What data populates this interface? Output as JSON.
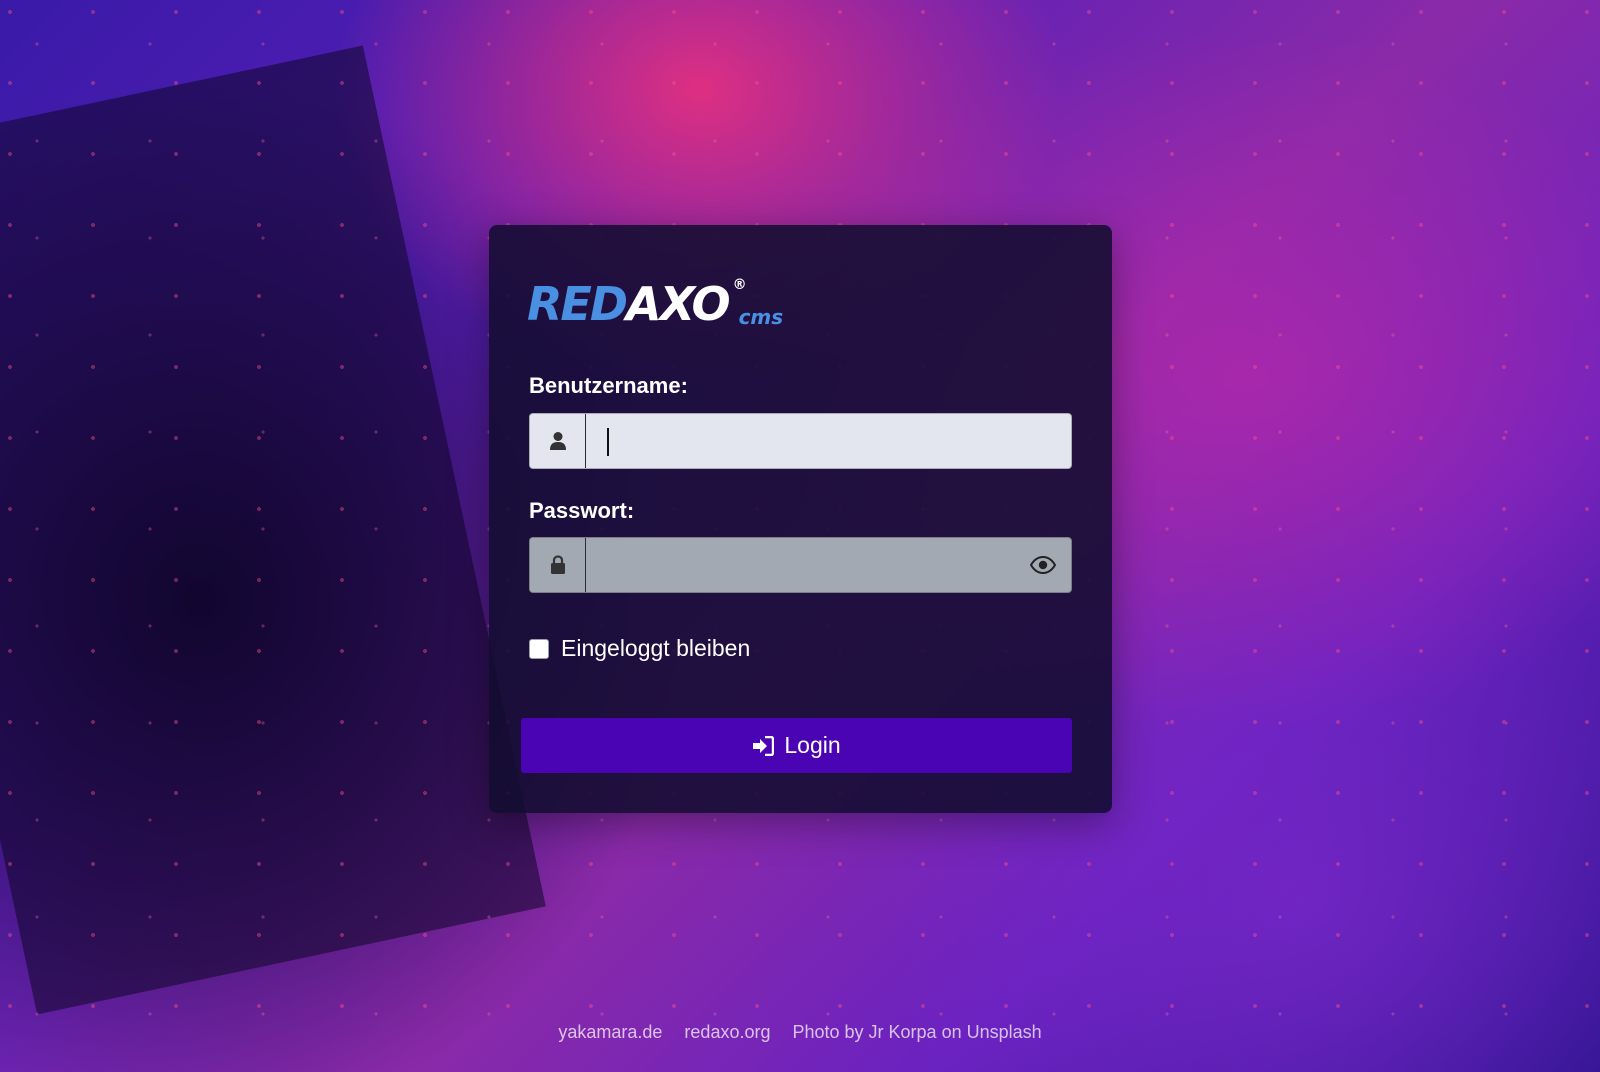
{
  "logo": {
    "part1": "RED",
    "part2": "AXO",
    "registered": "®",
    "suffix": "cms"
  },
  "form": {
    "username_label": "Benutzername:",
    "username_value": "",
    "password_label": "Passwort:",
    "password_value": "",
    "remember_label": "Eingeloggt bleiben",
    "remember_checked": false,
    "login_label": "Login"
  },
  "footer": {
    "links": [
      "yakamara.de",
      "redaxo.org",
      "Photo by Jr Korpa on Unsplash"
    ]
  },
  "icons": {
    "username": "user-icon",
    "password": "lock-icon",
    "show_password": "eye-icon",
    "login": "sign-in-icon"
  },
  "colors": {
    "logo_blue": "#4a90e2",
    "button": "#4a04b4",
    "card": "#120c30"
  }
}
